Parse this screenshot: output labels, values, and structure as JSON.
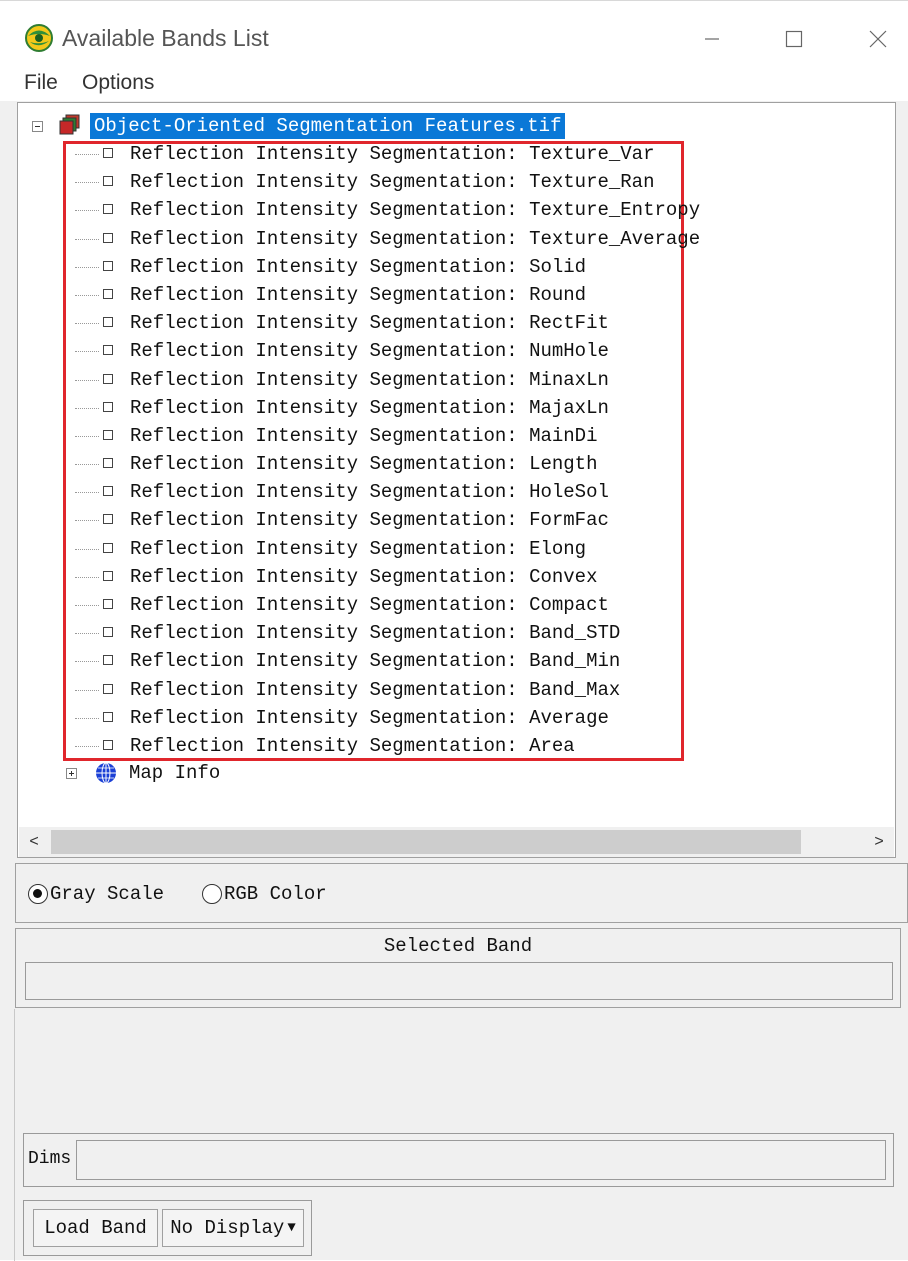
{
  "window": {
    "title": "Available Bands List",
    "controls": {
      "minimize": "—",
      "maximize": "☐",
      "close": "✕"
    }
  },
  "menubar": {
    "file": "File",
    "options": "Options"
  },
  "tree": {
    "root_label": "Object-Oriented Segmentation Features.tif",
    "bands": [
      "Reflection Intensity Segmentation: Texture_Var",
      "Reflection Intensity Segmentation: Texture_Ran",
      "Reflection Intensity Segmentation: Texture_Entropy",
      "Reflection Intensity Segmentation: Texture_Average",
      "Reflection Intensity Segmentation: Solid",
      "Reflection Intensity Segmentation: Round",
      "Reflection Intensity Segmentation: RectFit",
      "Reflection Intensity Segmentation: NumHole",
      "Reflection Intensity Segmentation: MinaxLn",
      "Reflection Intensity Segmentation: MajaxLn",
      "Reflection Intensity Segmentation: MainDi",
      "Reflection Intensity Segmentation: Length",
      "Reflection Intensity Segmentation: HoleSol",
      "Reflection Intensity Segmentation: FormFac",
      "Reflection Intensity Segmentation: Elong",
      "Reflection Intensity Segmentation: Convex",
      "Reflection Intensity Segmentation: Compact",
      "Reflection Intensity Segmentation: Band_STD",
      "Reflection Intensity Segmentation: Band_Min",
      "Reflection Intensity Segmentation: Band_Max",
      "Reflection Intensity Segmentation: Average",
      "Reflection Intensity Segmentation: Area"
    ],
    "map_info_label": "Map Info",
    "highlight_color": "#e0262c",
    "selection_color": "#0a78d7"
  },
  "scrollbar": {
    "left_arrow": "<",
    "right_arrow": ">"
  },
  "color_mode": {
    "gray_scale_label": "Gray Scale",
    "rgb_color_label": "RGB Color",
    "selected": "Gray Scale"
  },
  "selected_band": {
    "title": "Selected Band",
    "value": ""
  },
  "dims": {
    "label": "Dims",
    "value": ""
  },
  "buttons": {
    "load_band": "Load Band",
    "display": "No Display",
    "display_arrow": "▼"
  }
}
